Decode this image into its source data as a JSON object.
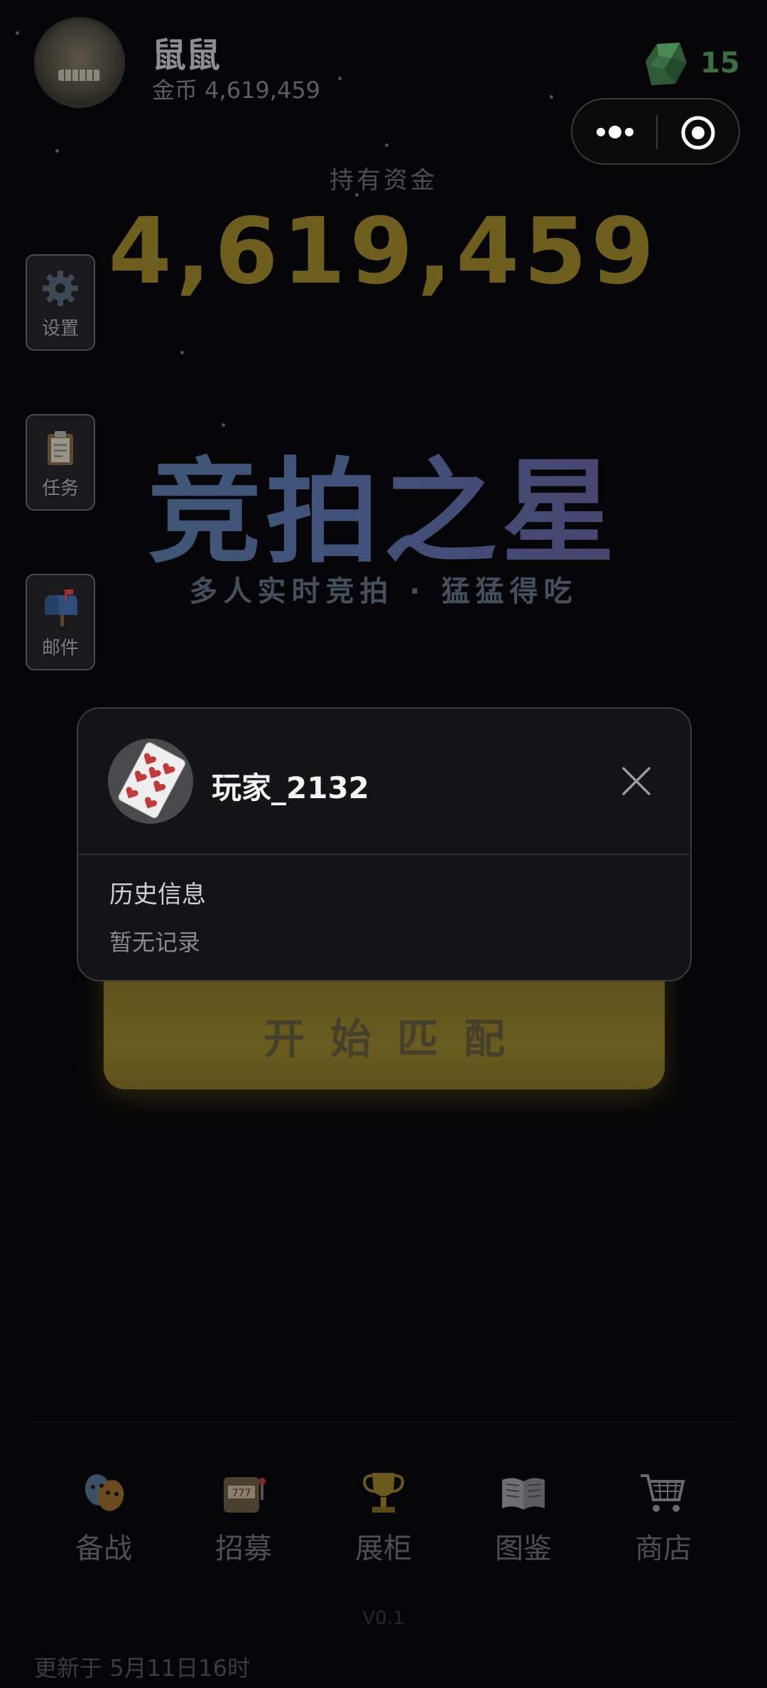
{
  "header": {
    "user_name": "鼠鼠",
    "gold_line": "金币 4,619,459",
    "gem_count": "15"
  },
  "capsule": {
    "more_icon": "more-dots-icon",
    "close_icon": "target-circle-icon"
  },
  "funds": {
    "label": "持有资金",
    "value": "4,619,459"
  },
  "side": {
    "settings": "设置",
    "tasks": "任务",
    "mail": "邮件"
  },
  "title": {
    "main": "竞拍之星",
    "subtitle": "多人实时竞拍 · 猛猛得吃"
  },
  "start_button": "开始匹配",
  "modal": {
    "player_name": "玩家_2132",
    "history_title": "历史信息",
    "no_records": "暂无记录"
  },
  "nav": [
    {
      "label": "备战",
      "icon": "masks-icon"
    },
    {
      "label": "招募",
      "icon": "slot-machine-icon"
    },
    {
      "label": "展柜",
      "icon": "trophy-icon"
    },
    {
      "label": "图鉴",
      "icon": "book-icon"
    },
    {
      "label": "商店",
      "icon": "cart-icon"
    }
  ],
  "footer": {
    "version": "V0.1",
    "updated": "更新于 5月11日16时"
  },
  "colors": {
    "gold": "#6e5f1f",
    "gem": "#3b6f43",
    "background": "#060608"
  }
}
